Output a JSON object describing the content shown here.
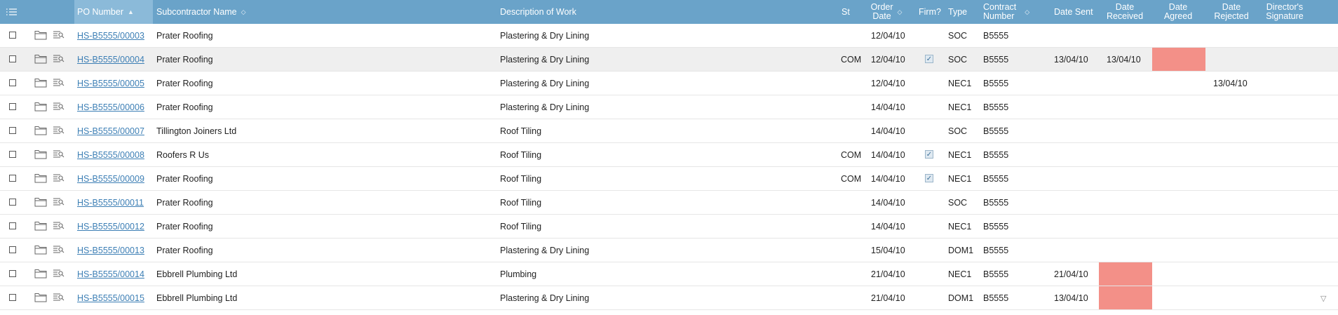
{
  "header": {
    "po_number": "PO Number",
    "subcontractor": "Subcontractor Name",
    "description": "Description of Work",
    "status": "St",
    "order_date_1": "Order",
    "order_date_2": "Date",
    "firm": "Firm?",
    "type": "Type",
    "contract_1": "Contract",
    "contract_2": "Number",
    "date_sent": "Date Sent",
    "date_received_1": "Date",
    "date_received_2": "Received",
    "date_agreed_1": "Date",
    "date_agreed_2": "Agreed",
    "date_rejected_1": "Date",
    "date_rejected_2": "Rejected",
    "director_1": "Director's",
    "director_2": "Signature"
  },
  "colors": {
    "header_bg": "#6aa3c9",
    "sorted_header_bg": "#8bbad9",
    "link": "#3d7fb5",
    "highlight": "#f39088"
  },
  "rows": [
    {
      "po": "HS-B5555/00003",
      "sub": "Prater Roofing",
      "desc": "Plastering & Dry Lining",
      "st": "",
      "date": "12/04/10",
      "firm": false,
      "type": "SOC",
      "contract": "B5555",
      "sent": "",
      "received": "",
      "agreed": "",
      "rejected": "",
      "hl_received": false,
      "hl_agreed": false
    },
    {
      "po": "HS-B5555/00004",
      "sub": "Prater Roofing",
      "desc": "Plastering & Dry Lining",
      "st": "COM",
      "date": "12/04/10",
      "firm": true,
      "type": "SOC",
      "contract": "B5555",
      "sent": "13/04/10",
      "received": "13/04/10",
      "agreed": "",
      "rejected": "",
      "hl_received": false,
      "hl_agreed": true
    },
    {
      "po": "HS-B5555/00005",
      "sub": "Prater Roofing",
      "desc": "Plastering & Dry Lining",
      "st": "",
      "date": "12/04/10",
      "firm": false,
      "type": "NEC1",
      "contract": "B5555",
      "sent": "",
      "received": "",
      "agreed": "",
      "rejected": "13/04/10",
      "hl_received": false,
      "hl_agreed": false
    },
    {
      "po": "HS-B5555/00006",
      "sub": "Prater Roofing",
      "desc": "Plastering & Dry Lining",
      "st": "",
      "date": "14/04/10",
      "firm": false,
      "type": "NEC1",
      "contract": "B5555",
      "sent": "",
      "received": "",
      "agreed": "",
      "rejected": "",
      "hl_received": false,
      "hl_agreed": false
    },
    {
      "po": "HS-B5555/00007",
      "sub": "Tillington Joiners Ltd",
      "desc": "Roof Tiling",
      "st": "",
      "date": "14/04/10",
      "firm": false,
      "type": "SOC",
      "contract": "B5555",
      "sent": "",
      "received": "",
      "agreed": "",
      "rejected": "",
      "hl_received": false,
      "hl_agreed": false
    },
    {
      "po": "HS-B5555/00008",
      "sub": "Roofers R Us",
      "desc": "Roof Tiling",
      "st": "COM",
      "date": "14/04/10",
      "firm": true,
      "type": "NEC1",
      "contract": "B5555",
      "sent": "",
      "received": "",
      "agreed": "",
      "rejected": "",
      "hl_received": false,
      "hl_agreed": false
    },
    {
      "po": "HS-B5555/00009",
      "sub": "Prater Roofing",
      "desc": "Roof Tiling",
      "st": "COM",
      "date": "14/04/10",
      "firm": true,
      "type": "NEC1",
      "contract": "B5555",
      "sent": "",
      "received": "",
      "agreed": "",
      "rejected": "",
      "hl_received": false,
      "hl_agreed": false
    },
    {
      "po": "HS-B5555/00011",
      "sub": "Prater Roofing",
      "desc": "Roof Tiling",
      "st": "",
      "date": "14/04/10",
      "firm": false,
      "type": "SOC",
      "contract": "B5555",
      "sent": "",
      "received": "",
      "agreed": "",
      "rejected": "",
      "hl_received": false,
      "hl_agreed": false
    },
    {
      "po": "HS-B5555/00012",
      "sub": "Prater Roofing",
      "desc": "Roof Tiling",
      "st": "",
      "date": "14/04/10",
      "firm": false,
      "type": "NEC1",
      "contract": "B5555",
      "sent": "",
      "received": "",
      "agreed": "",
      "rejected": "",
      "hl_received": false,
      "hl_agreed": false
    },
    {
      "po": "HS-B5555/00013",
      "sub": "Prater Roofing",
      "desc": "Plastering & Dry Lining",
      "st": "",
      "date": "15/04/10",
      "firm": false,
      "type": "DOM1",
      "contract": "B5555",
      "sent": "",
      "received": "",
      "agreed": "",
      "rejected": "",
      "hl_received": false,
      "hl_agreed": false
    },
    {
      "po": "HS-B5555/00014",
      "sub": "Ebbrell Plumbing Ltd",
      "desc": "Plumbing",
      "st": "",
      "date": "21/04/10",
      "firm": false,
      "type": "NEC1",
      "contract": "B5555",
      "sent": "21/04/10",
      "received": "",
      "agreed": "",
      "rejected": "",
      "hl_received": true,
      "hl_agreed": false
    },
    {
      "po": "HS-B5555/00015",
      "sub": "Ebbrell Plumbing Ltd",
      "desc": "Plastering & Dry Lining",
      "st": "",
      "date": "21/04/10",
      "firm": false,
      "type": "DOM1",
      "contract": "B5555",
      "sent": "13/04/10",
      "received": "",
      "agreed": "",
      "rejected": "",
      "hl_received": true,
      "hl_agreed": false
    }
  ]
}
